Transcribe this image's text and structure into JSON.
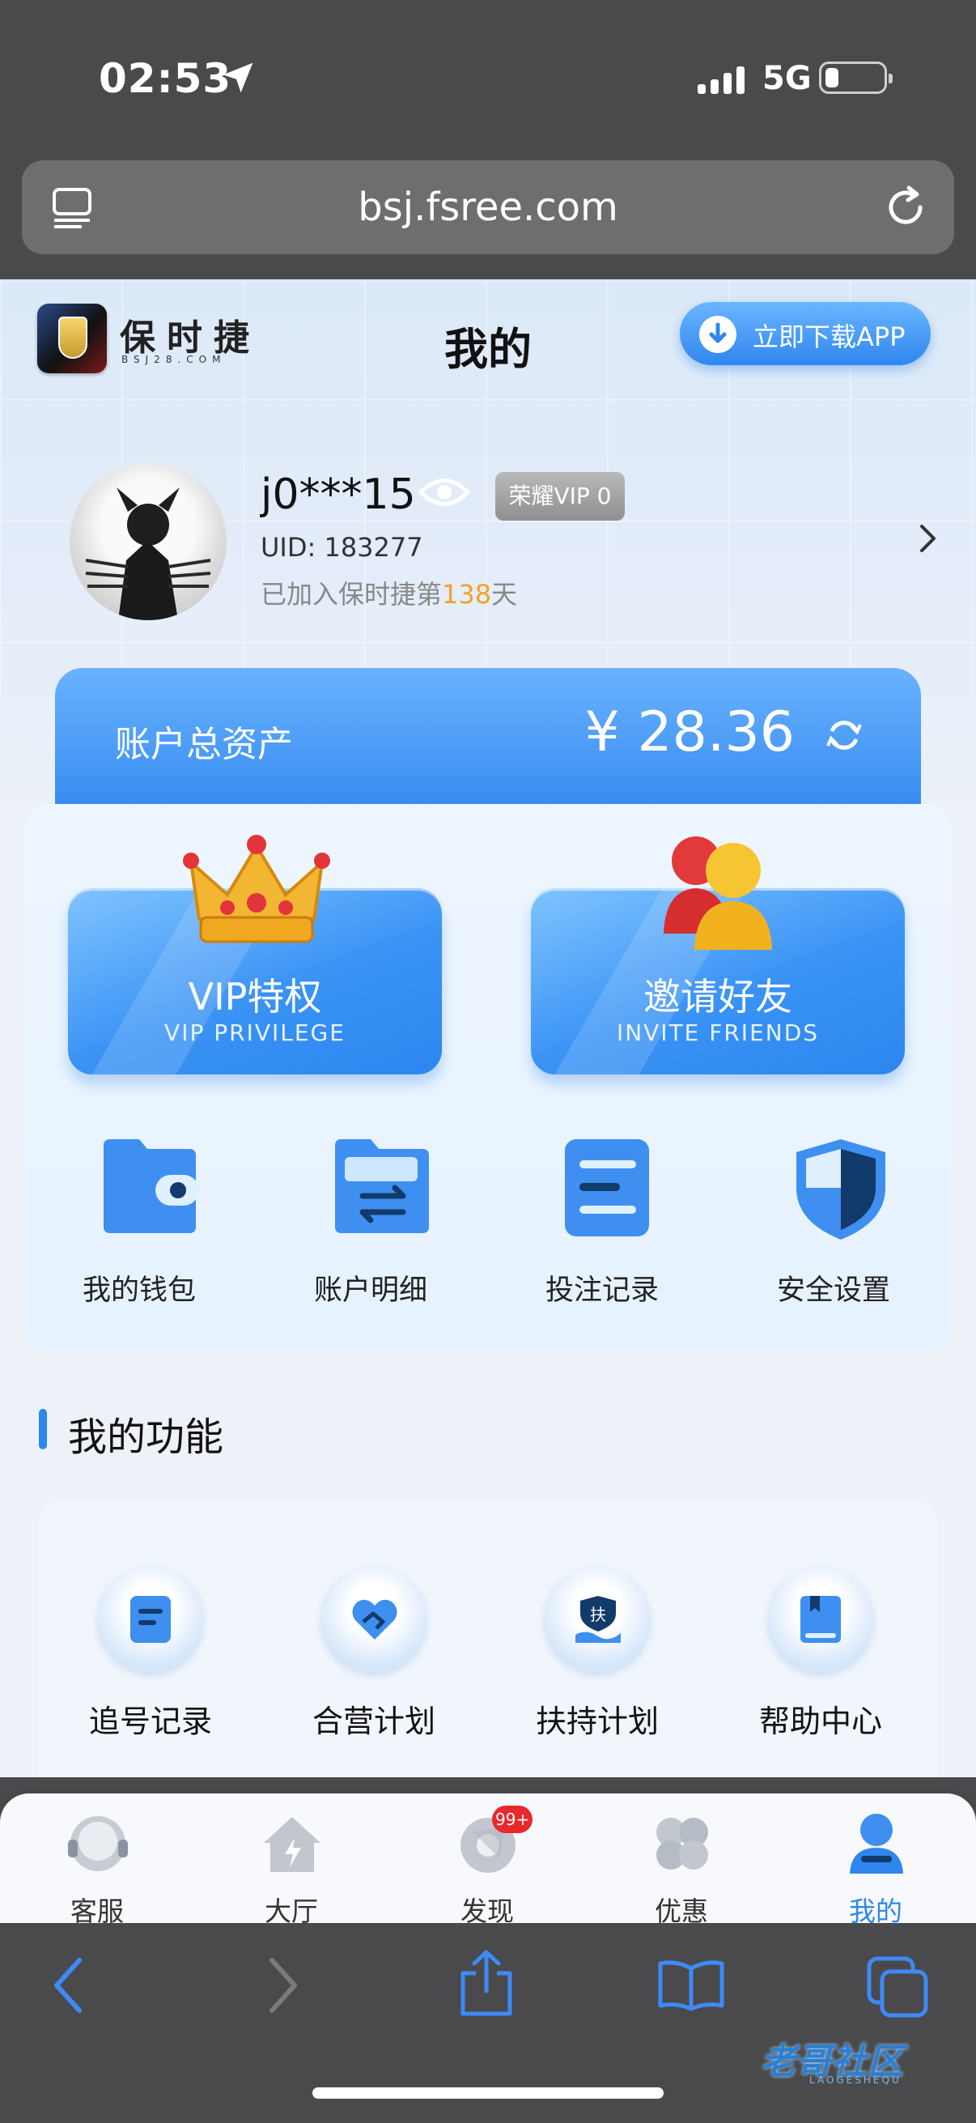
{
  "status_bar": {
    "time": "02:53",
    "network": "5G"
  },
  "browser": {
    "url": "bsj.fsree.com"
  },
  "header": {
    "brand_name": "保时捷",
    "brand_sub": "BSJ28.COM",
    "title": "我的",
    "download_label": "立即下载APP"
  },
  "profile": {
    "username": "j0***15",
    "vip_badge": "荣耀VIP 0",
    "uid": "UID: 183277",
    "joined_prefix": "已加入保时捷第",
    "joined_days": "138",
    "joined_suffix": "天"
  },
  "assets": {
    "label": "账户总资产",
    "value": "¥ 28.36"
  },
  "promo_cards": [
    {
      "title": "VIP特权",
      "subtitle": "VIP PRIVILEGE"
    },
    {
      "title": "邀请好友",
      "subtitle": "INVITE FRIENDS"
    }
  ],
  "quick_actions": [
    {
      "label": "我的钱包",
      "icon": "wallet-icon"
    },
    {
      "label": "账户明细",
      "icon": "folder-transfer-icon"
    },
    {
      "label": "投注记录",
      "icon": "document-icon"
    },
    {
      "label": "安全设置",
      "icon": "shield-icon"
    }
  ],
  "functions": {
    "title": "我的功能",
    "items": [
      {
        "label": "追号记录",
        "icon": "note-icon"
      },
      {
        "label": "合营计划",
        "icon": "handshake-heart-icon"
      },
      {
        "label": "扶持计划",
        "icon": "support-hand-icon",
        "glyph": "扶"
      },
      {
        "label": "帮助中心",
        "icon": "book-icon"
      }
    ]
  },
  "tabbar": {
    "items": [
      {
        "label": "客服",
        "icon": "headset-icon"
      },
      {
        "label": "大厅",
        "icon": "home-icon"
      },
      {
        "label": "发现",
        "icon": "discover-icon",
        "badge": "99+"
      },
      {
        "label": "优惠",
        "icon": "clover-icon"
      },
      {
        "label": "我的",
        "icon": "user-icon",
        "active": true
      }
    ]
  },
  "watermark": {
    "text": "老哥社区",
    "sub": "LAOGESHEQU"
  },
  "colors": {
    "accent": "#2f86ee",
    "highlight": "#f3a224",
    "badge": "#e8282d",
    "chrome": "#4a4a4c"
  }
}
